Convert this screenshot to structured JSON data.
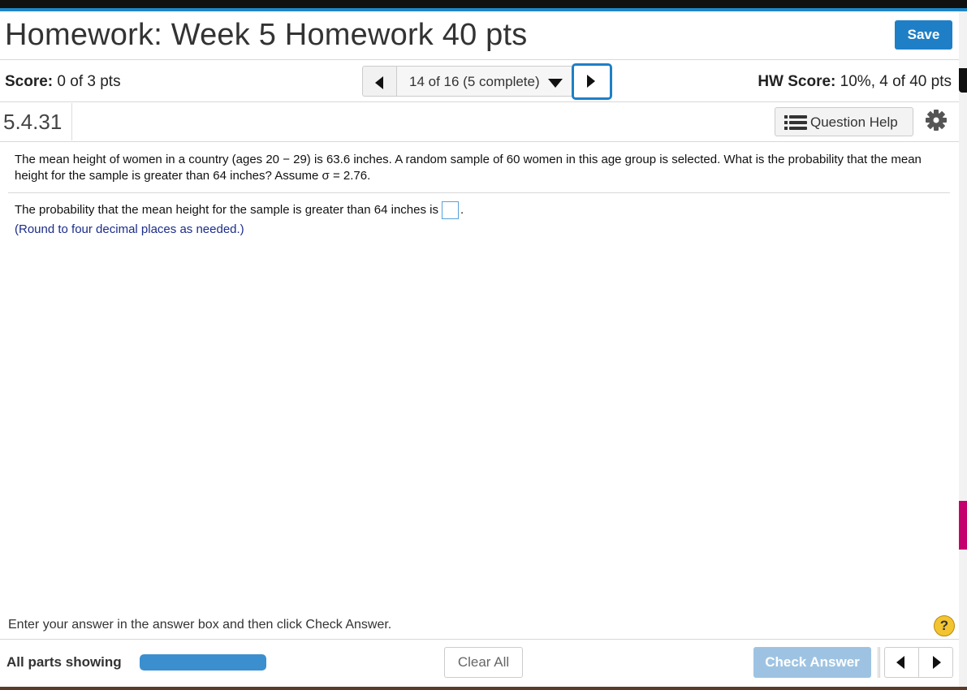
{
  "header": {
    "title": "Homework: Week 5 Homework 40 pts",
    "save_label": "Save"
  },
  "scorebar": {
    "score_label": "Score:",
    "score_value": "0 of 3 pts",
    "nav_position": "14 of 16 (5 complete)",
    "hw_score_label": "HW Score:",
    "hw_score_value": "10%, 4 of 40 pts"
  },
  "question": {
    "number": "5.4.31",
    "help_label": "Question Help",
    "problem_text": "The mean height of women in a country (ages 20 − 29) is 63.6 inches. A random sample of 60 women in this age group is selected. What is the probability that the mean height for the sample is greater than 64 inches? Assume σ = 2.76.",
    "answer_prompt": "The probability that the mean height for the sample is greater than 64 inches is",
    "answer_suffix": ".",
    "answer_value": "",
    "hint": "(Round to four decimal places as needed.)"
  },
  "footer": {
    "instruction": "Enter your answer in the answer box and then click Check Answer.",
    "help_symbol": "?",
    "parts_label": "All parts showing",
    "parts_progress": 1.0,
    "clear_label": "Clear All",
    "check_label": "Check Answer"
  },
  "icons": {
    "prev": "triangle-left-icon",
    "next": "triangle-right-icon",
    "dropdown": "caret-down-icon",
    "question_help": "list-icon",
    "settings": "gear-icon"
  },
  "colors": {
    "accent": "#1e7fc6",
    "check_disabled": "#9ec3e2",
    "hint_text": "#1b2c8a",
    "progress_fill": "#3b8fcf"
  }
}
